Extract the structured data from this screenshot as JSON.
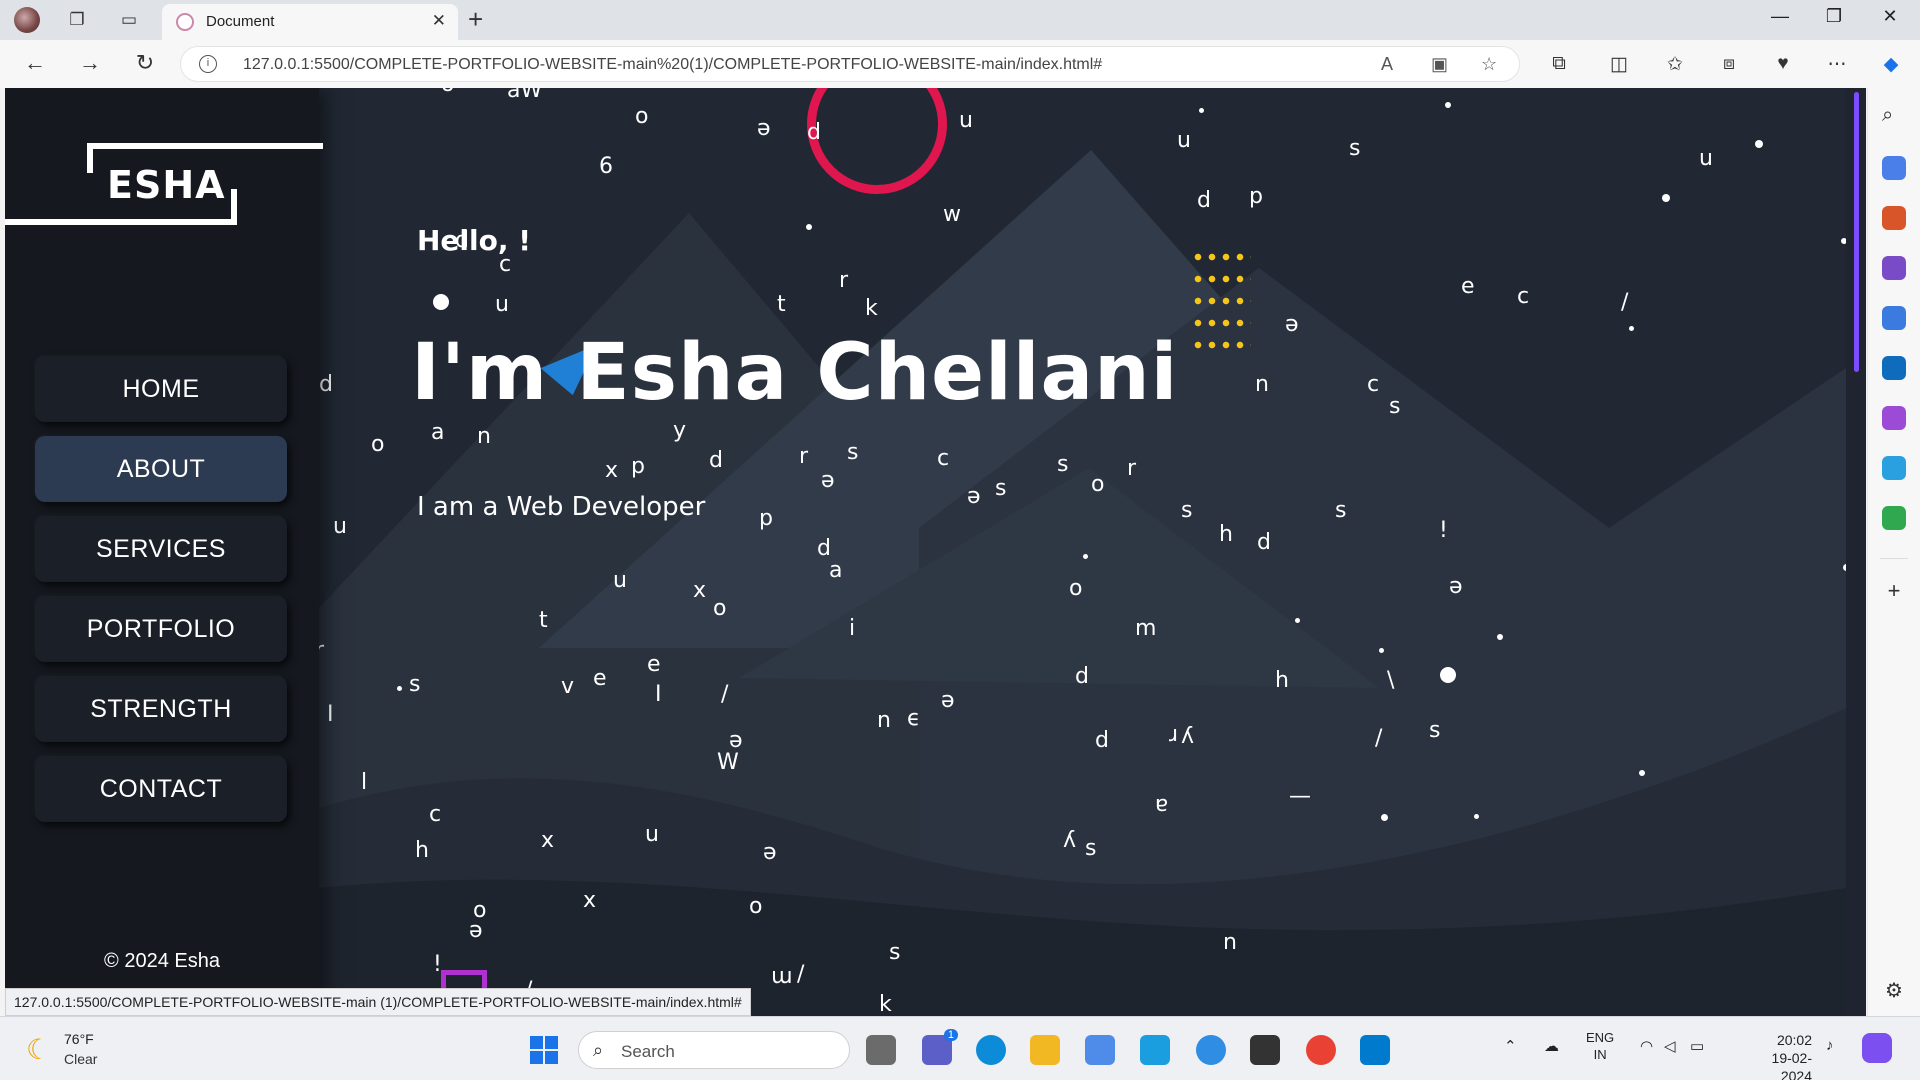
{
  "browser": {
    "tab_title": "Document",
    "url": "127.0.0.1:5500/COMPLETE-PORTFOLIO-WEBSITE-main%20(1)/COMPLETE-PORTFOLIO-WEBSITE-main/index.html#",
    "status_url": "127.0.0.1:5500/COMPLETE-PORTFOLIO-WEBSITE-main (1)/COMPLETE-PORTFOLIO-WEBSITE-main/index.html#"
  },
  "site": {
    "logo": "ESHA",
    "nav": [
      {
        "label": "HOME"
      },
      {
        "label": "ABOUT",
        "active": true
      },
      {
        "label": "SERVICES"
      },
      {
        "label": "PORTFOLIO"
      },
      {
        "label": "STRENGTH"
      },
      {
        "label": "CONTACT"
      }
    ],
    "copyright": "© 2024 Esha",
    "hero": {
      "greeting": "Hello, !",
      "name": "I'm Esha Chellani",
      "role": "I am a Web Developer"
    },
    "accent_color": "#e0164f",
    "background_color": "#212833"
  },
  "taskbar": {
    "temperature": "76°F",
    "weather": "Clear",
    "search_label": "Search",
    "language_1": "ENG",
    "language_2": "IN",
    "time": "20:02",
    "date": "19-02-2024",
    "chat_badge": "1"
  }
}
